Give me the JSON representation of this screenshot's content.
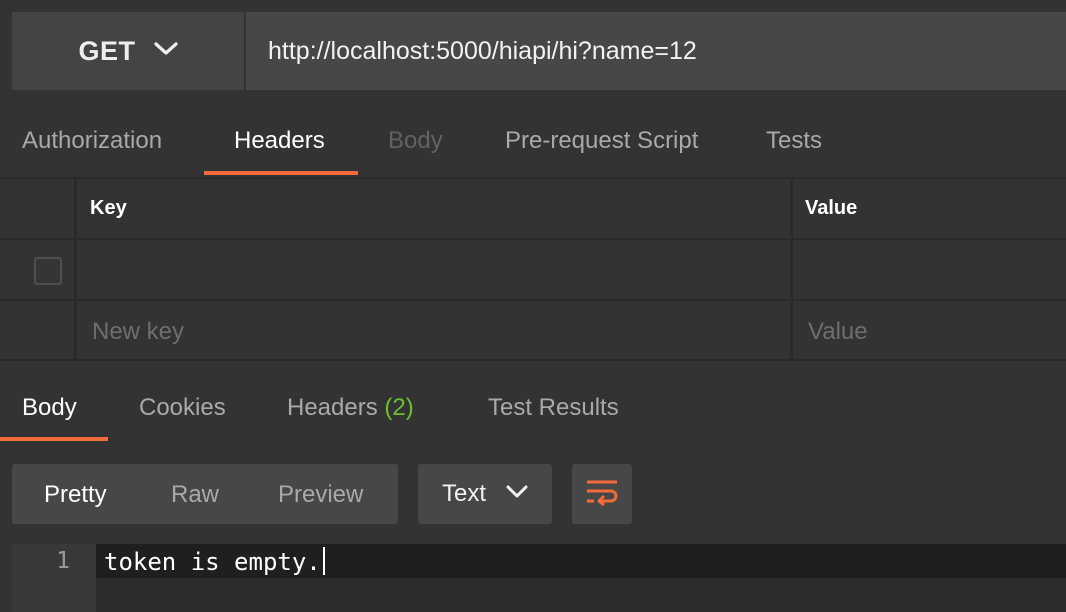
{
  "request": {
    "method": "GET",
    "url": "http://localhost:5000/hiapi/hi?name=12"
  },
  "request_tabs": {
    "authorization": "Authorization",
    "headers": "Headers",
    "body": "Body",
    "prerequest": "Pre-request Script",
    "tests": "Tests",
    "active": "Headers"
  },
  "headers_table": {
    "columns": {
      "key": "Key",
      "value": "Value"
    },
    "rows": [
      {
        "key": "",
        "value": "",
        "checked": false
      }
    ],
    "new_key_placeholder": "New key",
    "new_value_placeholder": "Value"
  },
  "response_tabs": {
    "body": "Body",
    "cookies": "Cookies",
    "headers": "Headers",
    "headers_count": "(2)",
    "test_results": "Test Results",
    "active": "Body"
  },
  "response_toolbar": {
    "pretty": "Pretty",
    "raw": "Raw",
    "preview": "Preview",
    "selected_view": "Pretty",
    "format": "Text"
  },
  "response_body": {
    "line_number": "1",
    "content": "token is empty."
  },
  "colors": {
    "accent": "#f26b3a",
    "count_green": "#6cbf2c",
    "background": "#333333"
  },
  "icons": {
    "method_dropdown": "chevron-down-icon",
    "format_dropdown": "chevron-down-icon",
    "wrap": "wrap-lines-icon"
  }
}
